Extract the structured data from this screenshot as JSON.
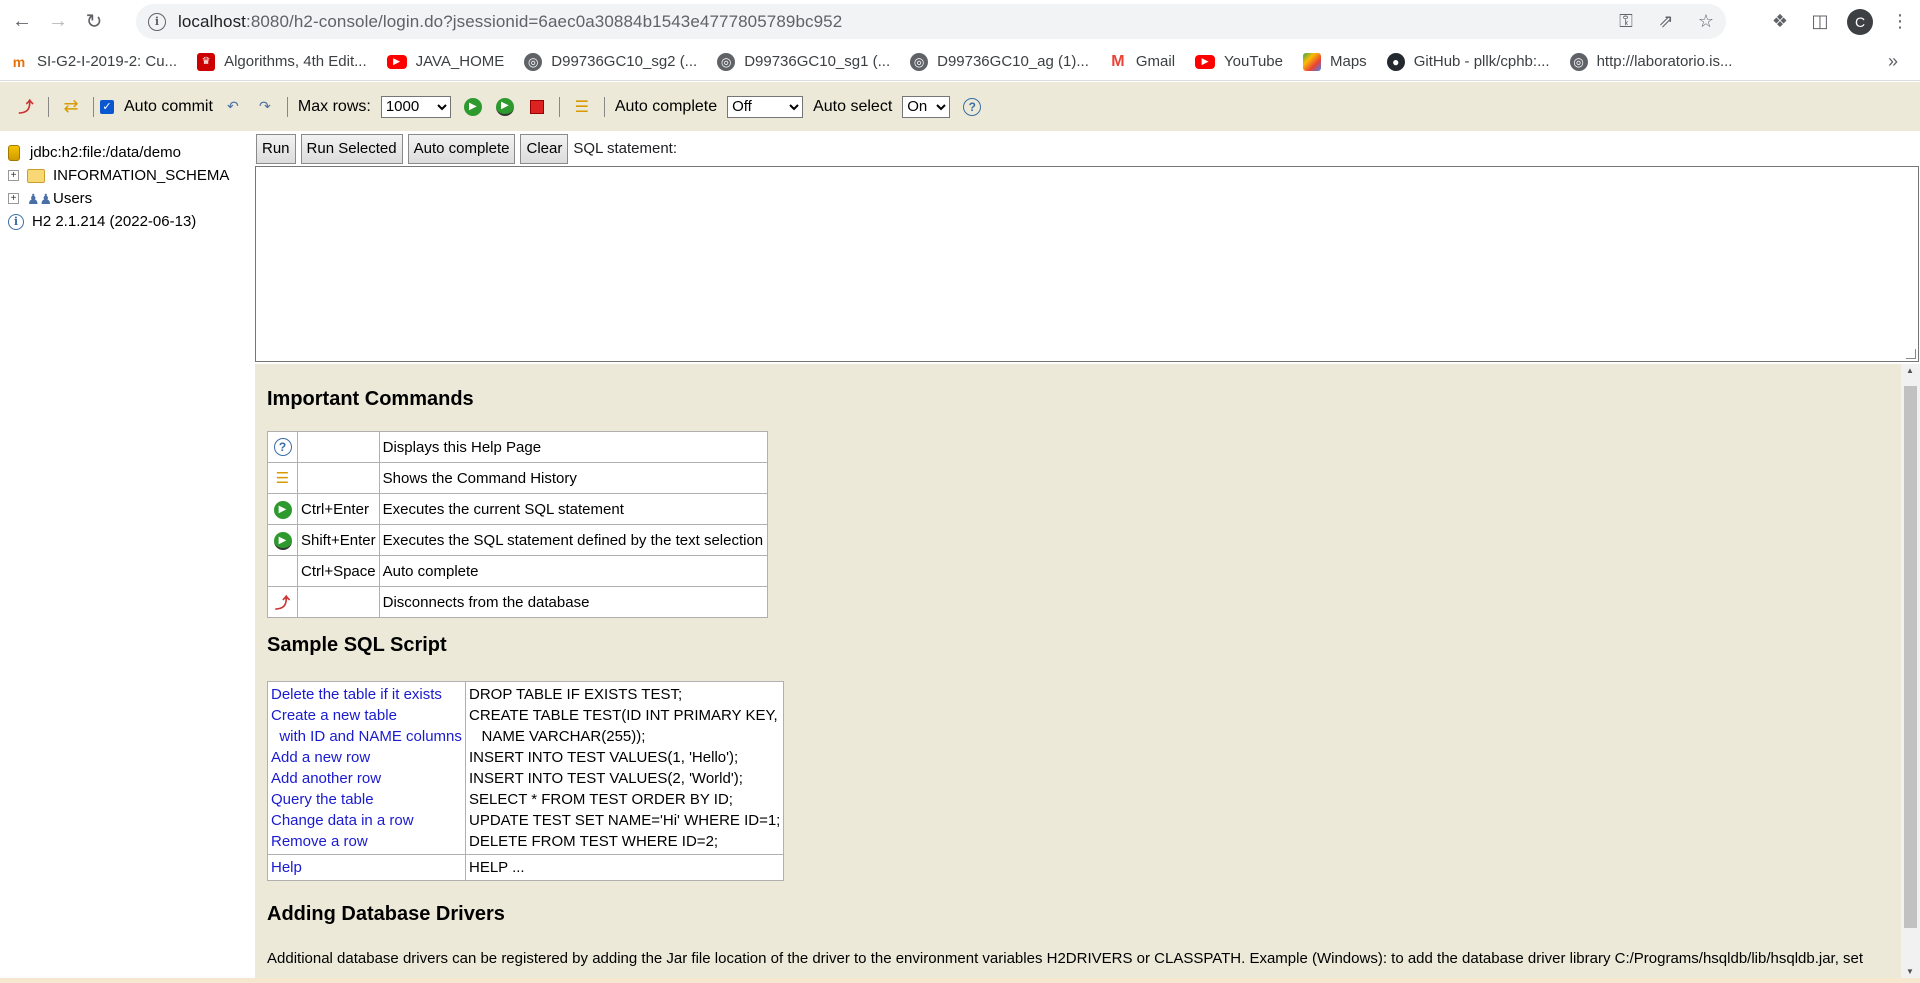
{
  "browser": {
    "url_host": "localhost",
    "url_rest": ":8080/h2-console/login.do?jsessionid=6aec0a30884b1543e4777805789bc952",
    "profile_initial": "C"
  },
  "bookmarks": [
    {
      "label": "SI-G2-I-2019-2: Cu...",
      "icon": "orange-logo-icon"
    },
    {
      "label": "Algorithms, 4th Edit...",
      "icon": "university-icon"
    },
    {
      "label": "JAVA_HOME",
      "icon": "youtube-icon"
    },
    {
      "label": "D99736GC10_sg2 (...",
      "icon": "globe-icon"
    },
    {
      "label": "D99736GC10_sg1 (...",
      "icon": "globe-icon"
    },
    {
      "label": "D99736GC10_ag (1)...",
      "icon": "globe-icon"
    },
    {
      "label": "Gmail",
      "icon": "gmail-icon"
    },
    {
      "label": "YouTube",
      "icon": "youtube-icon"
    },
    {
      "label": "Maps",
      "icon": "maps-icon"
    },
    {
      "label": "GitHub - pllk/cphb:...",
      "icon": "github-icon"
    },
    {
      "label": "http://laboratorio.is...",
      "icon": "globe-icon"
    }
  ],
  "h2toolbar": {
    "auto_commit_label": "Auto commit",
    "max_rows_label": "Max rows:",
    "max_rows_value": "1000",
    "auto_complete_label": "Auto complete",
    "auto_complete_value": "Off",
    "auto_select_label": "Auto select",
    "auto_select_value": "On"
  },
  "tree": {
    "connection": "jdbc:h2:file:/data/demo",
    "schema": "INFORMATION_SCHEMA",
    "users": "Users",
    "version": "H2 2.1.214 (2022-06-13)"
  },
  "sqlbar": {
    "run": "Run",
    "run_selected": "Run Selected",
    "auto_complete": "Auto complete",
    "clear": "Clear",
    "sql_label": "SQL statement:"
  },
  "help": {
    "important_title": "Important Commands",
    "commands": [
      {
        "key": "",
        "desc": "Displays this Help Page"
      },
      {
        "key": "",
        "desc": "Shows the Command History"
      },
      {
        "key": "Ctrl+Enter",
        "desc": "Executes the current SQL statement"
      },
      {
        "key": "Shift+Enter",
        "desc": "Executes the SQL statement defined by the text selection"
      },
      {
        "key": "Ctrl+Space",
        "desc": "Auto complete"
      },
      {
        "key": "",
        "desc": "Disconnects from the database"
      }
    ],
    "sample_title": "Sample SQL Script",
    "sample": {
      "left": [
        "Delete the table if it exists",
        "Create a new table",
        "  with ID and NAME columns",
        "Add a new row",
        "Add another row",
        "Query the table",
        "Change data in a row",
        "Remove a row"
      ],
      "right": [
        "DROP TABLE IF EXISTS TEST;",
        "CREATE TABLE TEST(ID INT PRIMARY KEY,",
        "   NAME VARCHAR(255));",
        "INSERT INTO TEST VALUES(1, 'Hello');",
        "INSERT INTO TEST VALUES(2, 'World');",
        "SELECT * FROM TEST ORDER BY ID;",
        "UPDATE TEST SET NAME='Hi' WHERE ID=1;",
        "DELETE FROM TEST WHERE ID=2;"
      ],
      "help_left": "Help",
      "help_right": "HELP ..."
    },
    "drivers_title": "Adding Database Drivers",
    "drivers_text": "Additional database drivers can be registered by adding the Jar file location of the driver to the environment variables H2DRIVERS or CLASSPATH. Example (Windows): to add the database driver library C:/Programs/hsqldb/lib/hsqldb.jar, set"
  }
}
